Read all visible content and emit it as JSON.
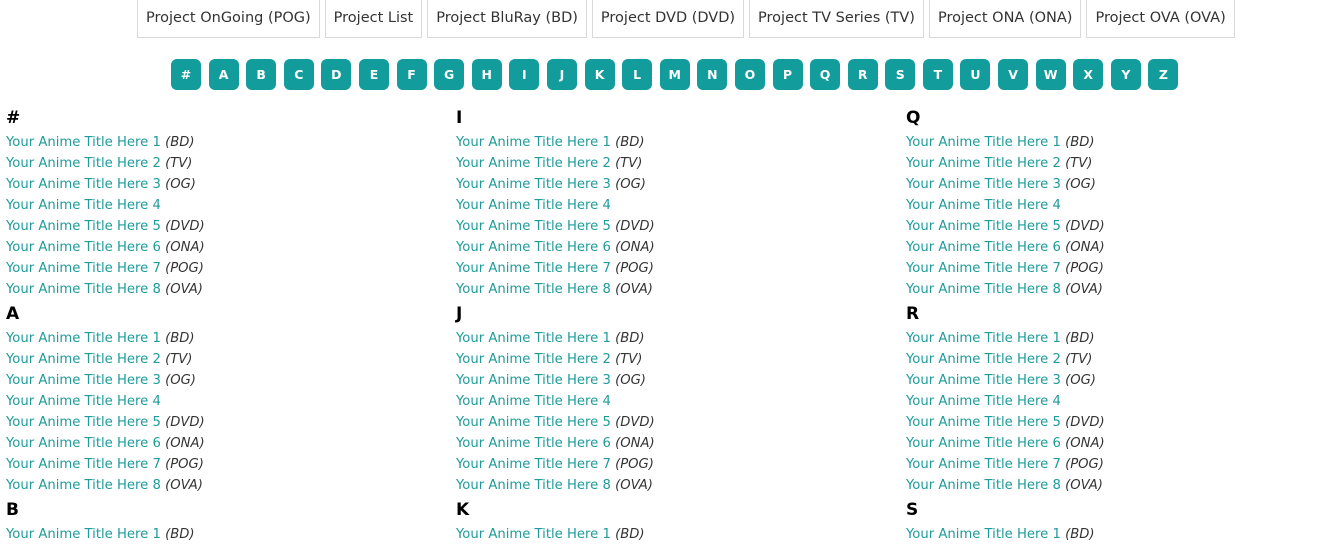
{
  "tabs": [
    "Project OnGoing (POG)",
    "Project List",
    "Project BluRay (BD)",
    "Project DVD (DVD)",
    "Project TV Series (TV)",
    "Project ONA (ONA)",
    "Project OVA (OVA)"
  ],
  "alphabet": [
    "#",
    "A",
    "B",
    "C",
    "D",
    "E",
    "F",
    "G",
    "H",
    "I",
    "J",
    "K",
    "L",
    "M",
    "N",
    "O",
    "P",
    "Q",
    "R",
    "S",
    "T",
    "U",
    "V",
    "W",
    "X",
    "Y",
    "Z"
  ],
  "colors": {
    "accent": "#129c9c",
    "link": "#1f9b9b"
  },
  "columns": [
    {
      "sections": [
        {
          "letter": "#",
          "entries": [
            {
              "title": "Your Anime Title Here 1",
              "tag": "(BD)"
            },
            {
              "title": "Your Anime Title Here 2",
              "tag": "(TV)"
            },
            {
              "title": "Your Anime Title Here 3",
              "tag": "(OG)"
            },
            {
              "title": "Your Anime Title Here 4",
              "tag": ""
            },
            {
              "title": "Your Anime Title Here 5",
              "tag": "(DVD)"
            },
            {
              "title": "Your Anime Title Here 6",
              "tag": "(ONA)"
            },
            {
              "title": "Your Anime Title Here 7",
              "tag": "(POG)"
            },
            {
              "title": "Your Anime Title Here 8",
              "tag": "(OVA)"
            }
          ]
        },
        {
          "letter": "A",
          "entries": [
            {
              "title": "Your Anime Title Here 1",
              "tag": "(BD)"
            },
            {
              "title": "Your Anime Title Here 2",
              "tag": "(TV)"
            },
            {
              "title": "Your Anime Title Here 3",
              "tag": "(OG)"
            },
            {
              "title": "Your Anime Title Here 4",
              "tag": ""
            },
            {
              "title": "Your Anime Title Here 5",
              "tag": "(DVD)"
            },
            {
              "title": "Your Anime Title Here 6",
              "tag": "(ONA)"
            },
            {
              "title": "Your Anime Title Here 7",
              "tag": "(POG)"
            },
            {
              "title": "Your Anime Title Here 8",
              "tag": "(OVA)"
            }
          ]
        },
        {
          "letter": "B",
          "entries": [
            {
              "title": "Your Anime Title Here 1",
              "tag": "(BD)"
            }
          ]
        }
      ]
    },
    {
      "sections": [
        {
          "letter": "I",
          "entries": [
            {
              "title": "Your Anime Title Here 1",
              "tag": "(BD)"
            },
            {
              "title": "Your Anime Title Here 2",
              "tag": "(TV)"
            },
            {
              "title": "Your Anime Title Here 3",
              "tag": "(OG)"
            },
            {
              "title": "Your Anime Title Here 4",
              "tag": ""
            },
            {
              "title": "Your Anime Title Here 5",
              "tag": "(DVD)"
            },
            {
              "title": "Your Anime Title Here 6",
              "tag": "(ONA)"
            },
            {
              "title": "Your Anime Title Here 7",
              "tag": "(POG)"
            },
            {
              "title": "Your Anime Title Here 8",
              "tag": "(OVA)"
            }
          ]
        },
        {
          "letter": "J",
          "entries": [
            {
              "title": "Your Anime Title Here 1",
              "tag": "(BD)"
            },
            {
              "title": "Your Anime Title Here 2",
              "tag": "(TV)"
            },
            {
              "title": "Your Anime Title Here 3",
              "tag": "(OG)"
            },
            {
              "title": "Your Anime Title Here 4",
              "tag": ""
            },
            {
              "title": "Your Anime Title Here 5",
              "tag": "(DVD)"
            },
            {
              "title": "Your Anime Title Here 6",
              "tag": "(ONA)"
            },
            {
              "title": "Your Anime Title Here 7",
              "tag": "(POG)"
            },
            {
              "title": "Your Anime Title Here 8",
              "tag": "(OVA)"
            }
          ]
        },
        {
          "letter": "K",
          "entries": [
            {
              "title": "Your Anime Title Here 1",
              "tag": "(BD)"
            }
          ]
        }
      ]
    },
    {
      "sections": [
        {
          "letter": "Q",
          "entries": [
            {
              "title": "Your Anime Title Here 1",
              "tag": "(BD)"
            },
            {
              "title": "Your Anime Title Here 2",
              "tag": "(TV)"
            },
            {
              "title": "Your Anime Title Here 3",
              "tag": "(OG)"
            },
            {
              "title": "Your Anime Title Here 4",
              "tag": ""
            },
            {
              "title": "Your Anime Title Here 5",
              "tag": "(DVD)"
            },
            {
              "title": "Your Anime Title Here 6",
              "tag": "(ONA)"
            },
            {
              "title": "Your Anime Title Here 7",
              "tag": "(POG)"
            },
            {
              "title": "Your Anime Title Here 8",
              "tag": "(OVA)"
            }
          ]
        },
        {
          "letter": "R",
          "entries": [
            {
              "title": "Your Anime Title Here 1",
              "tag": "(BD)"
            },
            {
              "title": "Your Anime Title Here 2",
              "tag": "(TV)"
            },
            {
              "title": "Your Anime Title Here 3",
              "tag": "(OG)"
            },
            {
              "title": "Your Anime Title Here 4",
              "tag": ""
            },
            {
              "title": "Your Anime Title Here 5",
              "tag": "(DVD)"
            },
            {
              "title": "Your Anime Title Here 6",
              "tag": "(ONA)"
            },
            {
              "title": "Your Anime Title Here 7",
              "tag": "(POG)"
            },
            {
              "title": "Your Anime Title Here 8",
              "tag": "(OVA)"
            }
          ]
        },
        {
          "letter": "S",
          "entries": [
            {
              "title": "Your Anime Title Here 1",
              "tag": "(BD)"
            }
          ]
        }
      ]
    }
  ]
}
